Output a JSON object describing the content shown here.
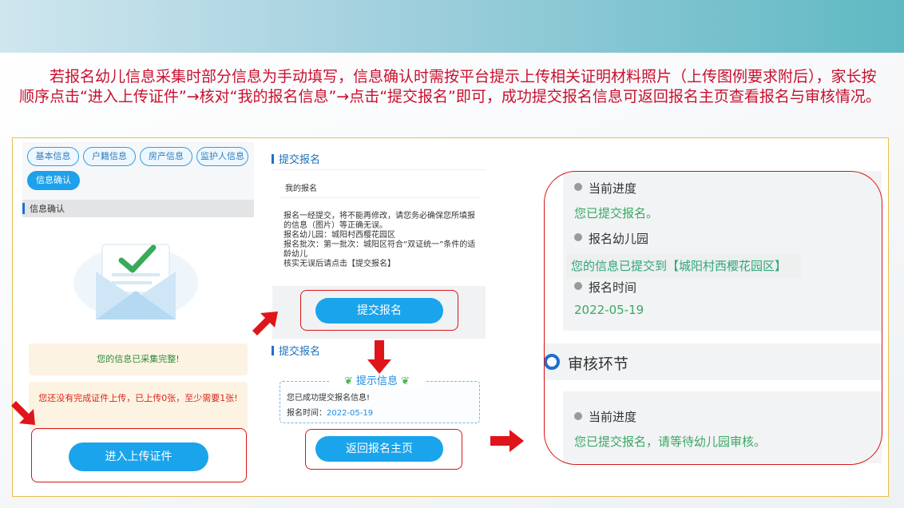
{
  "intro_text": "若报名幼儿信息采集时部分信息为手动填写，信息确认时需按平台提示上传相关证明材料照片（上传图例要求附后），家长按顺序点击“进入上传证件”→核对“我的报名信息”→点击“提交报名”即可，成功提交报名信息可返回报名主页查看报名与审核情况。",
  "panel1": {
    "tabs": [
      "基本信息",
      "户籍信息",
      "房产信息",
      "监护人信息",
      "信息确认"
    ],
    "section_title": "信息确认",
    "msg_complete": "您的信息已采集完整!",
    "msg_warning": "您还没有完成证件上传，已上传0张，至少需要1张!",
    "upload_button": "进入上传证件"
  },
  "panel2": {
    "section_title_1": "提交报名",
    "card_head": "我的报名",
    "card_body": [
      "报名一经提交，将不能再修改，请您务必确保您所填报的信息（图片）等正确无误。",
      "报名幼儿园：城阳村西樱花园区",
      "报名批次：第一批次：城阳区符合“双证统一”条件的适龄幼儿",
      "核实无误后请点击【提交报名】"
    ],
    "submit_button": "提交报名",
    "section_title_2": "提交报名",
    "tip_title": "提示信息",
    "tip_line1": "您已成功提交报名信息!",
    "tip_time_label": "报名时间：",
    "tip_time_value": "2022-05-19",
    "return_button": "返回报名主页"
  },
  "panel3": {
    "progress_label": "当前进度",
    "progress_value": "您已提交报名。",
    "kindergarten_label": "报名幼儿园",
    "kindergarten_value": "您的信息已提交到【城阳村西樱花园区】",
    "time_label": "报名时间",
    "time_value": "2022-05-19",
    "review_step": "审核环节",
    "progress_label_2": "当前进度",
    "progress_value_2": "您已提交报名，请等待幼儿园审核。"
  },
  "colors": {
    "accent_blue": "#1aa4ec",
    "annotation_red": "#d81616",
    "intro_red": "#c8102e",
    "status_green": "#3aa866"
  },
  "icons": [
    "envelope-check-icon",
    "red-arrow-icon",
    "leaf-icon",
    "ring-icon"
  ]
}
